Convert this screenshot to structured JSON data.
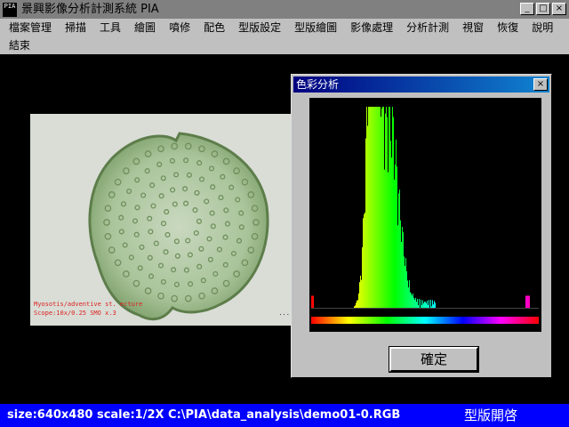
{
  "window": {
    "icon_label": "PIA",
    "title": "景興影像分析計測系統 PIA",
    "minimize": "_",
    "maximize": "□",
    "close": "×"
  },
  "menu": {
    "row1": [
      "檔案管理",
      "掃描",
      "工具",
      "繪圖",
      "噴修",
      "配色",
      "型版設定",
      "型版繪圖",
      "影像處理",
      "分析計測",
      "視窗",
      "恢復",
      "說明"
    ],
    "row2": [
      "結束"
    ]
  },
  "specimen": {
    "caption_line1": "Myosotis/adventive st. ecture",
    "caption_line2": "Scope:10x/0.25 SMO x.3",
    "mark": "..."
  },
  "dialog": {
    "title": "色彩分析",
    "close": "×",
    "ok_label": "確定"
  },
  "chart_data": {
    "type": "bar",
    "title": "",
    "xlabel": "",
    "ylabel": "",
    "x_axis": "hue (spectrum bar: red → yellow → green → cyan → blue → magenta → red)",
    "xlim": [
      0,
      255
    ],
    "ylim": [
      0,
      100
    ],
    "grid": false,
    "legend": "none",
    "peaks": [
      {
        "x": 68,
        "y": 95
      },
      {
        "x": 70,
        "y": 93
      },
      {
        "x": 86,
        "y": 58
      },
      {
        "x": 90,
        "y": 52
      }
    ]
  },
  "status": {
    "left": "size:640x480 scale:1/2X C:\\PIA\\data_analysis\\demo01-0.RGB",
    "right": "型版開啓"
  },
  "colors": {
    "statusbar": "#0000ff",
    "dialog_title_start": "#000080",
    "dialog_title_end": "#1084d0",
    "chrome": "#c0c0c0"
  }
}
